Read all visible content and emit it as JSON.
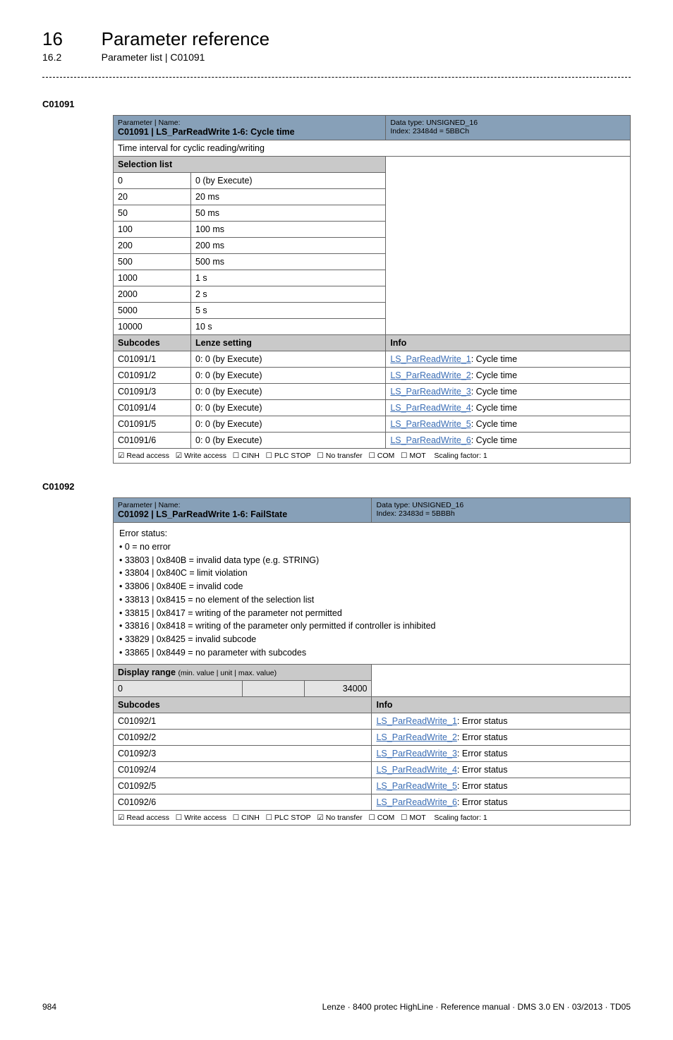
{
  "header": {
    "chapter_num": "16",
    "chapter_title": "Parameter reference",
    "sub_num": "16.2",
    "sub_title": "Parameter list | C01091"
  },
  "c01091": {
    "code": "C01091",
    "hdr_label": "Parameter | Name:",
    "hdr_name": "C01091 | LS_ParReadWrite 1-6: Cycle time",
    "hdr_dt_line1": "Data type: UNSIGNED_16",
    "hdr_dt_line2": "Index: 23484d = 5BBCh",
    "desc": "Time interval for cyclic reading/writing",
    "section_sel": "Selection list",
    "sel": [
      {
        "v": "0",
        "t": "0 (by Execute)"
      },
      {
        "v": "20",
        "t": "20 ms"
      },
      {
        "v": "50",
        "t": "50 ms"
      },
      {
        "v": "100",
        "t": "100 ms"
      },
      {
        "v": "200",
        "t": "200 ms"
      },
      {
        "v": "500",
        "t": "500 ms"
      },
      {
        "v": "1000",
        "t": "1 s"
      },
      {
        "v": "2000",
        "t": "2 s"
      },
      {
        "v": "5000",
        "t": "5 s"
      },
      {
        "v": "10000",
        "t": "10 s"
      }
    ],
    "col_sub": "Subcodes",
    "col_lenze": "Lenze setting",
    "col_info": "Info",
    "subs": [
      {
        "c": "C01091/1",
        "l": "0: 0 (by Execute)",
        "link": "LS_ParReadWrite_1",
        "suffix": ": Cycle time"
      },
      {
        "c": "C01091/2",
        "l": "0: 0 (by Execute)",
        "link": "LS_ParReadWrite_2",
        "suffix": ": Cycle time"
      },
      {
        "c": "C01091/3",
        "l": "0: 0 (by Execute)",
        "link": "LS_ParReadWrite_3",
        "suffix": ": Cycle time"
      },
      {
        "c": "C01091/4",
        "l": "0: 0 (by Execute)",
        "link": "LS_ParReadWrite_4",
        "suffix": ": Cycle time"
      },
      {
        "c": "C01091/5",
        "l": "0: 0 (by Execute)",
        "link": "LS_ParReadWrite_5",
        "suffix": ": Cycle time"
      },
      {
        "c": "C01091/6",
        "l": "0: 0 (by Execute)",
        "link": "LS_ParReadWrite_6",
        "suffix": ": Cycle time"
      }
    ],
    "access": {
      "read": "☑ Read access",
      "write": "☑ Write access",
      "cinh": "☐ CINH",
      "plc": "☐ PLC STOP",
      "notr": "☐ No transfer",
      "com": "☐ COM",
      "mot": "☐ MOT",
      "scale": "Scaling factor: 1"
    }
  },
  "c01092": {
    "code": "C01092",
    "hdr_label": "Parameter | Name:",
    "hdr_name": "C01092 | LS_ParReadWrite 1-6: FailState",
    "hdr_dt_line1": "Data type: UNSIGNED_16",
    "hdr_dt_line2": "Index: 23483d = 5BBBh",
    "desc_lines": [
      "Error status:",
      "• 0 = no error",
      "• 33803 | 0x840B = invalid data type (e.g. STRING)",
      "• 33804 | 0x840C = limit violation",
      "• 33806 | 0x840E = invalid code",
      "• 33813 | 0x8415 = no element of the selection list",
      "• 33815 | 0x8417 = writing of the parameter not permitted",
      "• 33816 | 0x8418 = writing of the parameter only permitted if controller is inhibited",
      "• 33829 | 0x8425 = invalid subcode",
      "• 33865 | 0x8449 = no parameter with subcodes"
    ],
    "display_range_label": "Display range",
    "display_range_sub": "(min. value | unit | max. value)",
    "dr_min": "0",
    "dr_unit": "",
    "dr_max": "34000",
    "col_sub": "Subcodes",
    "col_info": "Info",
    "subs": [
      {
        "c": "C01092/1",
        "link": "LS_ParReadWrite_1",
        "suffix": ": Error status"
      },
      {
        "c": "C01092/2",
        "link": "LS_ParReadWrite_2",
        "suffix": ": Error status"
      },
      {
        "c": "C01092/3",
        "link": "LS_ParReadWrite_3",
        "suffix": ": Error status"
      },
      {
        "c": "C01092/4",
        "link": "LS_ParReadWrite_4",
        "suffix": ": Error status"
      },
      {
        "c": "C01092/5",
        "link": "LS_ParReadWrite_5",
        "suffix": ": Error status"
      },
      {
        "c": "C01092/6",
        "link": "LS_ParReadWrite_6",
        "suffix": ": Error status"
      }
    ],
    "access": {
      "read": "☑ Read access",
      "write": "☐ Write access",
      "cinh": "☐ CINH",
      "plc": "☐ PLC STOP",
      "notr": "☑ No transfer",
      "com": "☐ COM",
      "mot": "☐ MOT",
      "scale": "Scaling factor: 1"
    }
  },
  "footer": {
    "page": "984",
    "info": "Lenze · 8400 protec HighLine · Reference manual · DMS 3.0 EN · 03/2013 · TD05"
  }
}
